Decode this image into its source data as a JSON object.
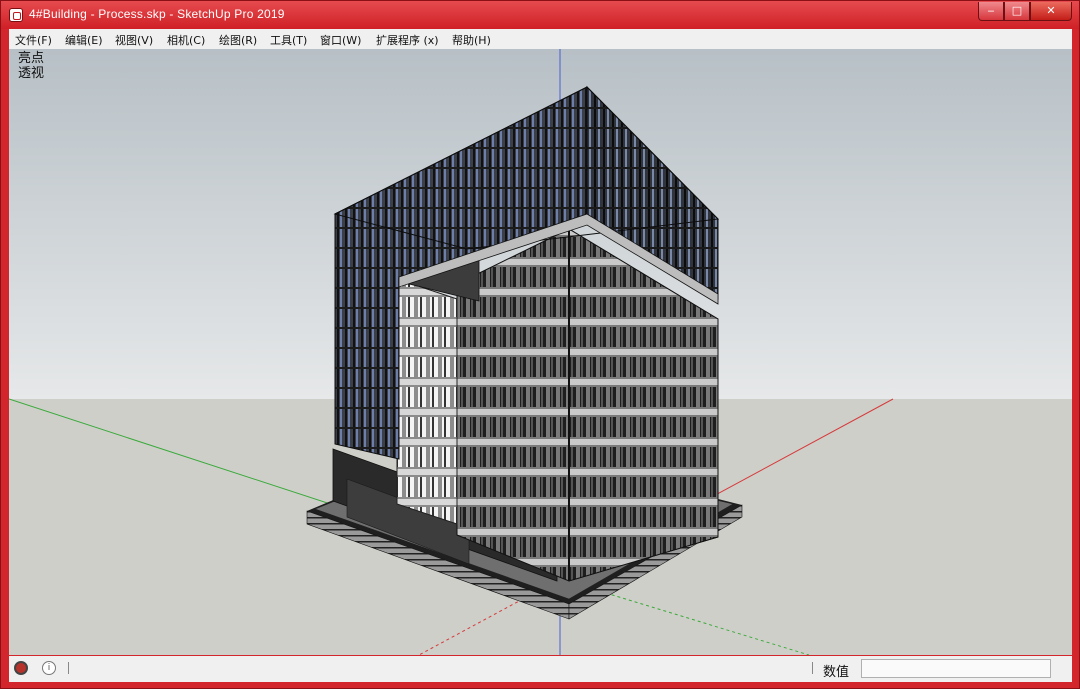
{
  "window": {
    "title": "4#Building - Process.skp - SketchUp Pro 2019",
    "controls": {
      "minimize": "‒",
      "maximize": "□",
      "close": "✕"
    }
  },
  "menu": [
    {
      "label": "文件(F)"
    },
    {
      "label": "编辑(E)"
    },
    {
      "label": "视图(V)"
    },
    {
      "label": "相机(C)"
    },
    {
      "label": "绘图(R)"
    },
    {
      "label": "工具(T)"
    },
    {
      "label": "窗口(W)"
    },
    {
      "label": "扩展程序 (x)"
    },
    {
      "label": "帮助(H)"
    }
  ],
  "viewport": {
    "scene_label": "亮点",
    "camera_label": "透视"
  },
  "statusbar": {
    "geo_icon": "geolocation-icon",
    "info_icon": "info-icon",
    "info_glyph": "i",
    "measurements_label": "数值",
    "measurements_value": ""
  },
  "colors": {
    "window_frame": "#d3262c",
    "sky_top": "#b7c0c6",
    "sky_bottom": "#e6e8e9",
    "ground": "#cfcfca",
    "axis_red": "#d63a3a",
    "axis_green": "#3aaa3a",
    "axis_blue": "#4a5fd0"
  }
}
